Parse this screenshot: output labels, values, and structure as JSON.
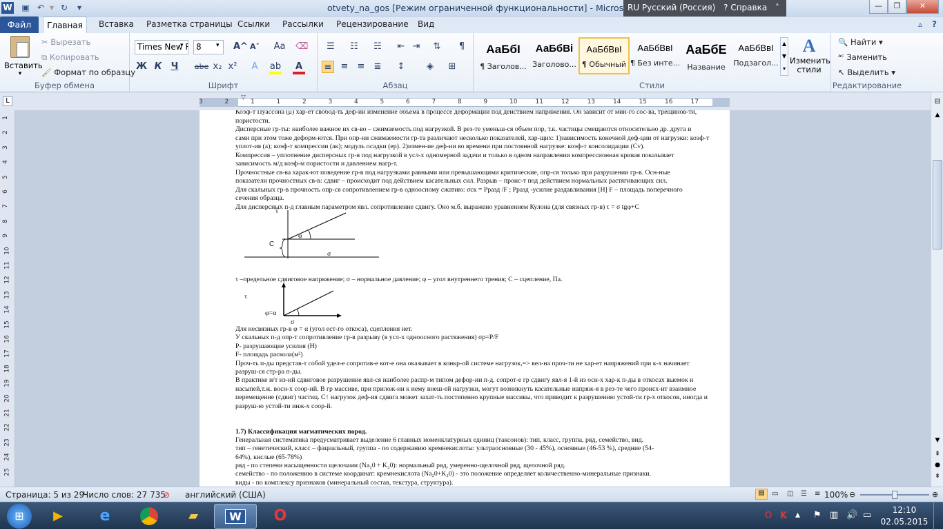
{
  "window": {
    "title": "otvety_na_gos [Режим ограниченной функциональности]  -  Microsoft Word",
    "language": "RU Русский (Россия)",
    "help": "Справка"
  },
  "tabs": [
    "Файл",
    "Главная",
    "Вставка",
    "Разметка страницы",
    "Ссылки",
    "Рассылки",
    "Рецензирование",
    "Вид"
  ],
  "clipboard": {
    "paste": "Вставить",
    "cut": "Вырезать",
    "copy": "Копировать",
    "format_painter": "Формат по образцу",
    "group": "Буфер обмена"
  },
  "font": {
    "name": "Times New Ro",
    "size": "8",
    "group": "Шрифт",
    "bold": "Ж",
    "italic": "К",
    "underline": "Ч",
    "strike": "abe",
    "sub": "x₂",
    "sup": "x²",
    "case": "Аа",
    "grow": "A^",
    "shrink": "A˅"
  },
  "paragraph": {
    "group": "Абзац"
  },
  "styles": {
    "group": "Стили",
    "items": [
      {
        "preview": "АаБбI",
        "name": "¶ Заголов..."
      },
      {
        "preview": "АаБбВі",
        "name": "Заголово..."
      },
      {
        "preview": "АаБбВвІ",
        "name": "¶ Обычный"
      },
      {
        "preview": "АаБбВвІ",
        "name": "¶ Без инте..."
      },
      {
        "preview": "АаБбЕ",
        "name": "Название"
      },
      {
        "preview": "АаБбВвІ",
        "name": "Подзагол..."
      }
    ],
    "change": "Изменить стили"
  },
  "editing": {
    "group": "Редактирование",
    "find": "Найти",
    "replace": "Заменить",
    "select": "Выделить"
  },
  "ruler_marks": [
    "3",
    "2",
    "1",
    "1",
    "2",
    "3",
    "4",
    "5",
    "6",
    "7",
    "8",
    "9",
    "10",
    "11",
    "12",
    "13",
    "14",
    "15",
    "16",
    "17"
  ],
  "vruler_marks": [
    "1",
    "2",
    "3",
    "4",
    "5",
    "6",
    "7",
    "8",
    "9",
    "10",
    "11",
    "12",
    "13",
    "14",
    "15",
    "16",
    "17",
    "18",
    "19",
    "20",
    "21",
    "22",
    "23",
    "24",
    "25"
  ],
  "document": {
    "lines": [
      "Коэф-т Пуассона (μ) хар-ет свобод-ть деф-ии изменение объема в процессе деформации под действием напряжения. Он зависит от мин-го сос-ва, трещинов-ти,",
      "пористости.",
      "    Дисперсные гр-ты: наиболее важное их св-во – сжимаемость под нагрузкой. В рез-те уменьш-ся объем пор, т.к. частицы смещаются относительно др. друга и",
      "сами при этом тоже деформ-ются. При опр-ии сжимаемости гр-та различают несколько показателей, хар-щих: 1)зависимость конечной деф-ции от нагрузки: коэф-т",
      "уплот-ия (а); коэф-т компрессии (ак); модуль осадки (ер). 2)измен-ие деф-ии во времени при постоянной нагрузке: коэф-т консолидации (Сv).",
      "    Компрессия – уплотнение дисперсных гр-в под нагрузкой в усл-х одномерной задачи и только в одном направлении компрессионная кривая показывает",
      "зависимость м/д коэф-м пористости и давлением нагр-т.",
      "      Прочностные св-ва харак-ют поведение гр-в под нагрузками равными или превышающими критические, опр-ся только при разрушении гр-в. Осн-ные",
      "показатели прочностных св-в: сдвиг – происходит под действием касательных сил. Разрыв – проис-т под действием нормальных растягивающих сил.",
      "    Для скальных гр-в прочность опр-ся сопротивлением гр-в одноосному сжатию: σск = Рразд /F  ; Рразд -усилие раздавливания [Н] F – площадь  поперечного",
      "сечения образца.",
      "    Для дисперсных п-д главным параметром явл. сопротивление сдвигу. Оно м.б. выражено уравнением Кулона (для связных гр-в) τ = σ tgφ+С"
    ],
    "legend1": "    τ –предельное сдвиговое напряжение; σ – нормальное давление; φ – угол внутреннего трения; С – сцепление, Па.",
    "lines2": [
      "    Для несвязных гр-в φ = α  (угол ест-го откоса), сцепления нет.",
      "    У скальных п-д опр-т сопротивление гр-в разрыву (в усл-х одноосного растяжения) σр=Р/F",
      "    Р- разрушающие усилия (Н)",
      "    F- площадь раскола(м²)",
      "        Проч-ть п-ды представ-т собой удел-е сопротив-е кот-е она оказывает в конкр-ой системе нагрузок,=> вел-на проч-ти не хар-ет напряжений при к-х начинает",
      "разруш-ся стр-ра п-ды.",
      "    В практике и/т из-ий сдвиговое разрушение явл-ся наиболее распр-м типом дефор-ии п-д. сопрот-е гр сдвигу явл-я 1-й из осн-х хар-к п-ды в откосах выемок и",
      "насыпей,т.ж. восн-х соор-ий. В гр массиве, при прилож-ии к нему внеш-ей нагрузки, могут возникнуть касательные напряж-я в рез-те чего происх-ит взаимное",
      "перемещение (сдвиг) частиц. С↑ нагрузок деф-ия сдвига может захат-ть постепенно крупные массивы, что приводит к разрушению устой-ти гр-х откосов, иногда и",
      "разруш-ю устой-ти инж-х соор-й."
    ],
    "heading": "1.7) Классификация магматических пород.",
    "lines3": [
      "    Генеральная систематика предусматривает выделение 6 главных номенклатурных единиц (таксонов): тип, класс, группа, ряд, семейство, вид.",
      "    тип – генетический, класс – фациальный, группа - по содержанию кремнекислоты: ультраосновные (30 - 45%), основные (46-53 %), средние (54-",
      "64%), кислые (65-78%)",
      "    ряд - по степени насыщенности щелочами     (Na₂0 + K₂0): нормальный ряд, умеренно-щелочной ряд, щелочной ряд.",
      "    семейство - по положению в системе координат: кремнекислота (Na₂0+K₂0) - это положение определяет         количественно-минеральные признаки.",
      "    виды - по комплексу признаков (минеральный состав, текстура, структура)."
    ],
    "fig1": {
      "tau": "τ",
      "phi": "φ",
      "c": "С",
      "sigma": "σ"
    },
    "fig2": {
      "tau": "τ",
      "phi": "φ=α",
      "sigma": "σ"
    }
  },
  "status": {
    "page": "Страница: 5 из 29",
    "words": "Число слов: 27 735",
    "lang": "английский (США)",
    "zoom": "100%"
  },
  "clock": {
    "time": "12:10",
    "date": "02.05.2015"
  }
}
